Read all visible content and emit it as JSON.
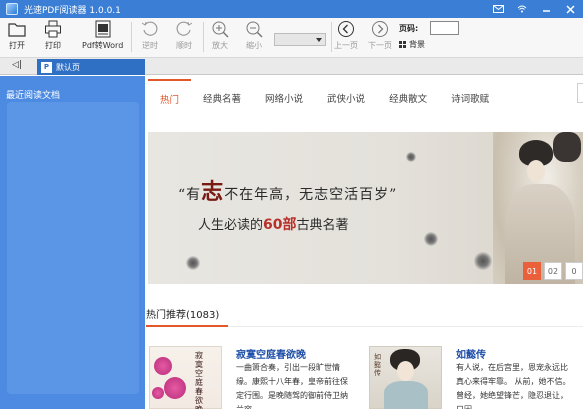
{
  "window": {
    "title": "光速PDF阅读器 1.0.0.1",
    "controls": [
      "mail-icon",
      "wifi-icon",
      "minimize-icon",
      "close-icon"
    ]
  },
  "toolbar": {
    "open": "打开",
    "print": "打印",
    "pdf_to_word": "Pdf转Word",
    "rotate_ccw": "逆时",
    "rotate_cw": "顺时",
    "zoom_in": "放大",
    "zoom_out": "缩小",
    "zoom_value": "",
    "prev_page": "上一页",
    "next_page": "下一页",
    "page_label": "页码:",
    "page_value": "",
    "background": "背景"
  },
  "tabbar": {
    "collapse": "◁|",
    "doc_tab_icon": "P",
    "doc_tab_label": "默认页"
  },
  "sidebar": {
    "title": "最近阅读文档",
    "items": []
  },
  "categories": [
    {
      "label": "热门",
      "active": true
    },
    {
      "label": "经典名著",
      "active": false
    },
    {
      "label": "网络小说",
      "active": false
    },
    {
      "label": "武侠小说",
      "active": false
    },
    {
      "label": "经典散文",
      "active": false
    },
    {
      "label": "诗词歌赋",
      "active": false
    }
  ],
  "banner": {
    "quote_open": "“有",
    "quote_big": "志",
    "quote_rest": "不在年高，无志空活百岁”",
    "tagline_pre": "人生必读的",
    "tagline_num": "60部",
    "tagline_post": "古典名著",
    "pages": [
      "01",
      "02",
      "0"
    ],
    "active_page": "01"
  },
  "section": {
    "title": "热门推荐(1083)"
  },
  "books": [
    {
      "title": "寂寞空庭春欲晚",
      "cover_text": "寂寞空庭春欲晚",
      "desc": "一曲箫合奏，引出一段旷世情缘。康熙十八年春，皇帝前往保定行围。是晚随驾的御前侍卫纳兰容"
    },
    {
      "title": "如懿传",
      "cover_text": "如懿传",
      "desc": "有人说，在后宫里，恩宠永远比真心来得牢靠。 从前，她不信。 曾经，她绝望锋芒，隐忍退让，只因"
    }
  ],
  "colors": {
    "titlebar": "#3a7fd5",
    "sidebar": "#4d8be2",
    "accent": "#e2582a",
    "book_title": "#1f4fa8"
  }
}
